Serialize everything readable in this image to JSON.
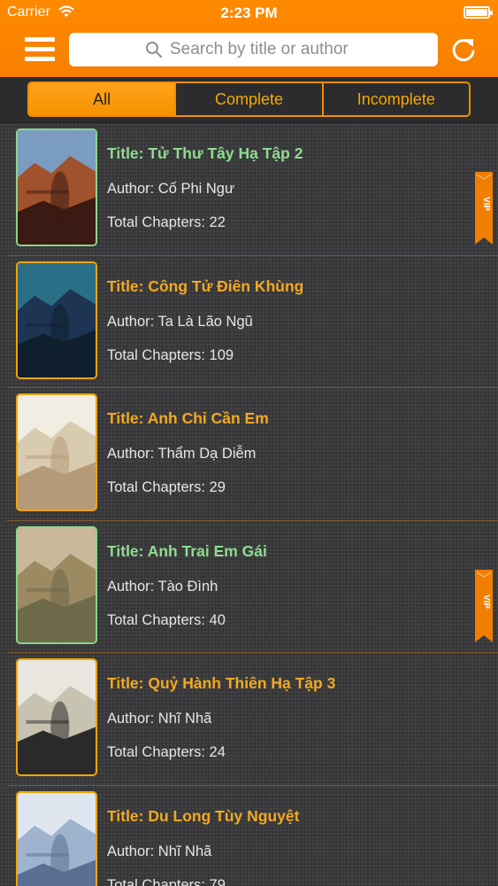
{
  "status_bar": {
    "carrier": "Carrier",
    "time": "2:23 PM"
  },
  "nav": {
    "search_placeholder": "Search by title or author",
    "icons": [
      "hamburger-menu-icon",
      "search-icon",
      "refresh-icon"
    ]
  },
  "filters": [
    {
      "label": "All",
      "selected": true
    },
    {
      "label": "Complete",
      "selected": false
    },
    {
      "label": "Incomplete",
      "selected": false
    }
  ],
  "colors": {
    "accent": "#f88600",
    "title_vip": "#8fdc8f",
    "title_normal": "#f2a920",
    "vip_badge": "#f07e00"
  },
  "books": [
    {
      "title": "Title: Tử Thư Tây Hạ Tập 2",
      "author": "Author: Cố Phi Ngư",
      "chapters": "Total Chapters: 22",
      "vip": true,
      "vip_label": "VIP",
      "cover_colors": [
        "#7a9cc0",
        "#a0522d",
        "#3a1a12"
      ]
    },
    {
      "title": "Title: Công Tử Điên Khùng",
      "author": "Author: Ta Là Lão Ngũ",
      "chapters": "Total Chapters: 109",
      "vip": false,
      "cover_colors": [
        "#2b6f86",
        "#1d3552",
        "#0f1f2e"
      ]
    },
    {
      "title": "Title: Anh Chỉ Cần Em",
      "author": "Author: Thẩm Dạ Diễm",
      "chapters": "Total Chapters: 29",
      "vip": false,
      "cover_colors": [
        "#f2ede2",
        "#d9cbb0",
        "#b59a78"
      ]
    },
    {
      "title": "Title: Anh Trai Em Gái",
      "author": "Author: Tào Đình",
      "chapters": "Total Chapters: 40",
      "vip": true,
      "vip_label": "VIP",
      "cover_colors": [
        "#c9b99a",
        "#9c8a63",
        "#6e6a4a"
      ]
    },
    {
      "title": "Title: Quỷ Hành Thiên Hạ Tập 3",
      "author": "Author: Nhĩ Nhã",
      "chapters": "Total Chapters: 24",
      "vip": false,
      "cover_colors": [
        "#e8e6df",
        "#c8c2b0",
        "#2a2a2a"
      ]
    },
    {
      "title": "Title: Du Long Tùy Nguyệt",
      "author": "Author: Nhĩ Nhã",
      "chapters": "Total Chapters: 79",
      "vip": false,
      "cover_colors": [
        "#dfe6f0",
        "#9fb3cf",
        "#5a6f92"
      ]
    }
  ]
}
